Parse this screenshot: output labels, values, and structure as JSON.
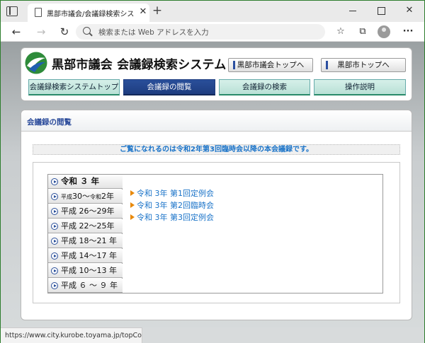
{
  "browser": {
    "tab_title": "黒部市議会/会議録検索システム",
    "tab_close": "✕",
    "new_tab": "+",
    "address_placeholder": "検索または Web アドレスを入力",
    "status_url": "https://www.city.kurobe.toyama.jp/topCouncil.as..."
  },
  "header": {
    "site_title": "黒部市議会 会議録検索システム",
    "links": [
      "黒部市議会トップへ",
      "黒部市トップへ"
    ],
    "nav_tabs": [
      {
        "label": "会議録検索システムトップ",
        "active": false
      },
      {
        "label": "会議録の閲覧",
        "active": true
      },
      {
        "label": "会議録の検索",
        "active": false
      },
      {
        "label": "操作説明",
        "active": false
      }
    ]
  },
  "section": {
    "title": "会議録の閲覧",
    "notice": "ご覧になれるのは令和2年第3回臨時会以降の本会議録です。"
  },
  "eras": [
    {
      "label": "令和 ３ 年",
      "selected": true
    },
    {
      "label_pre_small": "平成",
      "label_mid": "30～",
      "label_small2": "令和",
      "label_end": "2年",
      "selected": false
    },
    {
      "label": "平成 26～29年",
      "selected": false
    },
    {
      "label": "平成 22～25年",
      "selected": false
    },
    {
      "label": "平成 18～21 年",
      "selected": false
    },
    {
      "label": "平成 14～17 年",
      "selected": false
    },
    {
      "label": "平成 10～13 年",
      "selected": false
    },
    {
      "label": "平成 ６ ～ ９ 年",
      "selected": false
    }
  ],
  "meetings": [
    "令和 3年 第1回定例会",
    "令和 3年 第2回臨時会",
    "令和 3年 第3回定例会"
  ],
  "colors": {
    "active_tab": "#1e3d80",
    "inactive_tab": "#c4e7de",
    "link": "#1a73c8",
    "bullet": "#e8890a"
  }
}
